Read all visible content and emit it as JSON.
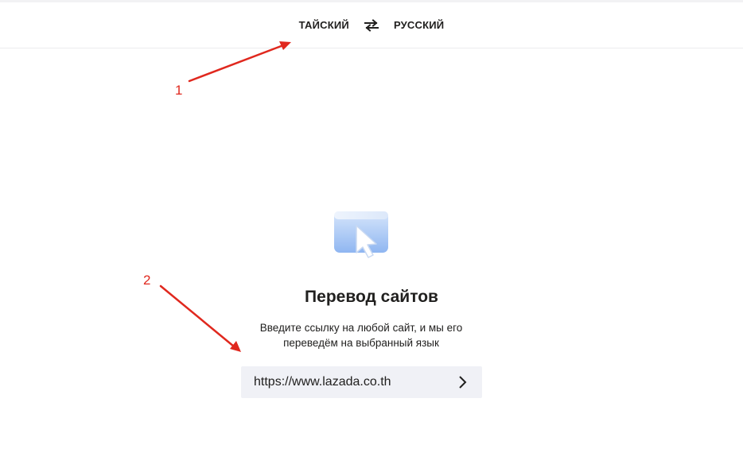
{
  "language_bar": {
    "source_language": "ТАЙСКИЙ",
    "target_language": "РУССКИЙ",
    "swap_icon": "swap-arrows-icon"
  },
  "main": {
    "hero_icon": "website-cursor-icon",
    "title": "Перевод сайтов",
    "description": "Введите ссылку на любой сайт, и мы его переведём на выбранный язык",
    "url_input": {
      "value": "https://www.lazada.co.th",
      "go_icon": "chevron-right-icon"
    }
  },
  "annotations": {
    "marker_1": "1",
    "marker_2": "2",
    "color": "#e0281e"
  }
}
